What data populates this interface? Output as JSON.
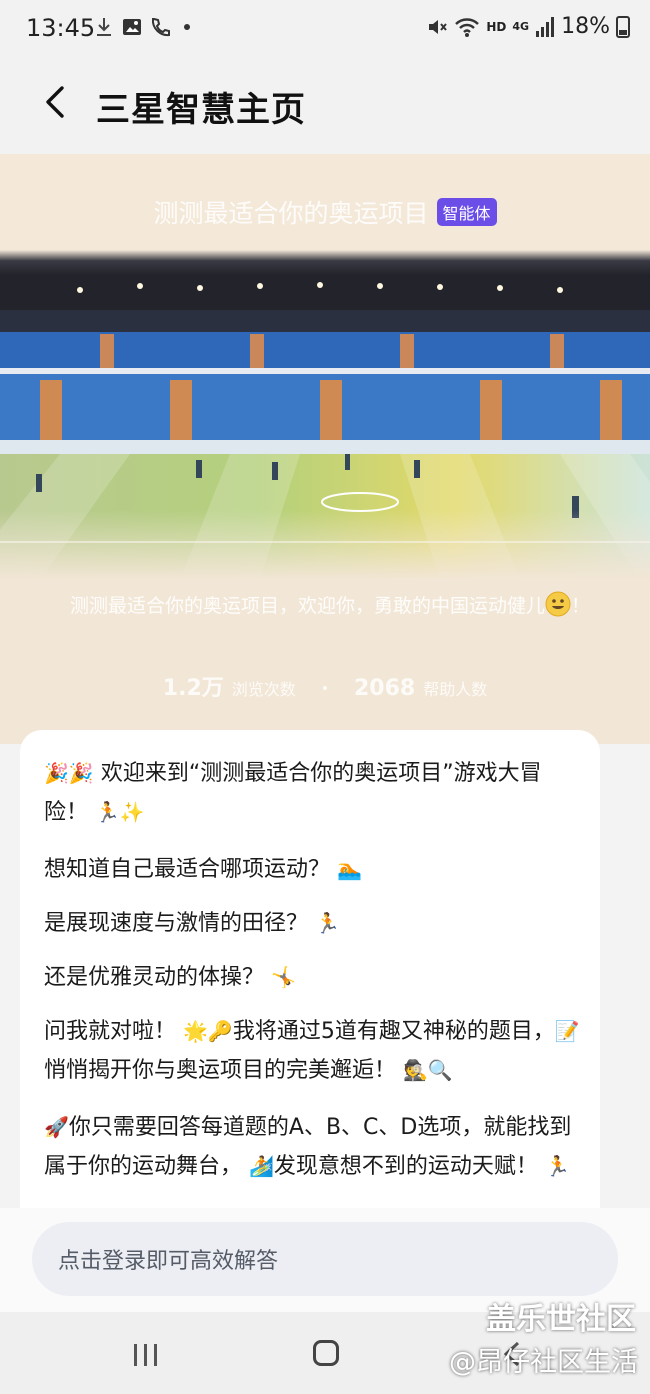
{
  "status_bar": {
    "time": "13:45",
    "hd": "HD",
    "network": "4G",
    "battery": "18%"
  },
  "header": {
    "title": "三星智慧主页"
  },
  "hero": {
    "title": "测测最适合你的奥运项目",
    "badge": "智能体",
    "description": "测测最适合你的奥运项目，欢迎你，勇敢的中国运动健儿",
    "description_tail": "！",
    "stats": [
      {
        "value": "1.2万",
        "label": "浏览次数"
      },
      {
        "value": "2068",
        "label": "帮助人数"
      }
    ]
  },
  "messages": [
    {
      "text": "欢迎来到“测测最适合你的奥运项目”游戏大冒险！",
      "pre": "🎉🎉",
      "post": "🏃✨"
    },
    {
      "text": "想知道自己最适合哪项运动？",
      "pre": "",
      "post": "🏊"
    },
    {
      "text": "是展现速度与激情的田径？",
      "pre": "",
      "post": "🏃"
    },
    {
      "text": "还是优雅灵动的体操？",
      "pre": "",
      "post": "🤸"
    },
    {
      "text": "问我就对啦！",
      "pre": "",
      "post": "🌟🔑"
    },
    {
      "text": "我将通过5道有趣又神秘的题目，",
      "pre": "",
      "post": "📝"
    },
    {
      "text": "悄悄揭开你与奥运项目的完美邂逅！",
      "pre": "",
      "post": "🕵🔍"
    },
    {
      "text": "你只需要回答每道题的A、B、C、D选项，就能找到属于你的运动舞台，",
      "pre": "🚀",
      "post": "🏄"
    },
    {
      "text": "发现意想不到的运动天赋！",
      "pre": "",
      "post": "🏃"
    }
  ],
  "input": {
    "placeholder": "点击登录即可高效解答"
  },
  "watermark": {
    "line1": "盖乐世社区",
    "line2": "@昂仔社区生活"
  },
  "colors": {
    "badge": "#6b4de8",
    "hero_bg": "#f4e9d8",
    "input_bg": "#eceef3"
  }
}
